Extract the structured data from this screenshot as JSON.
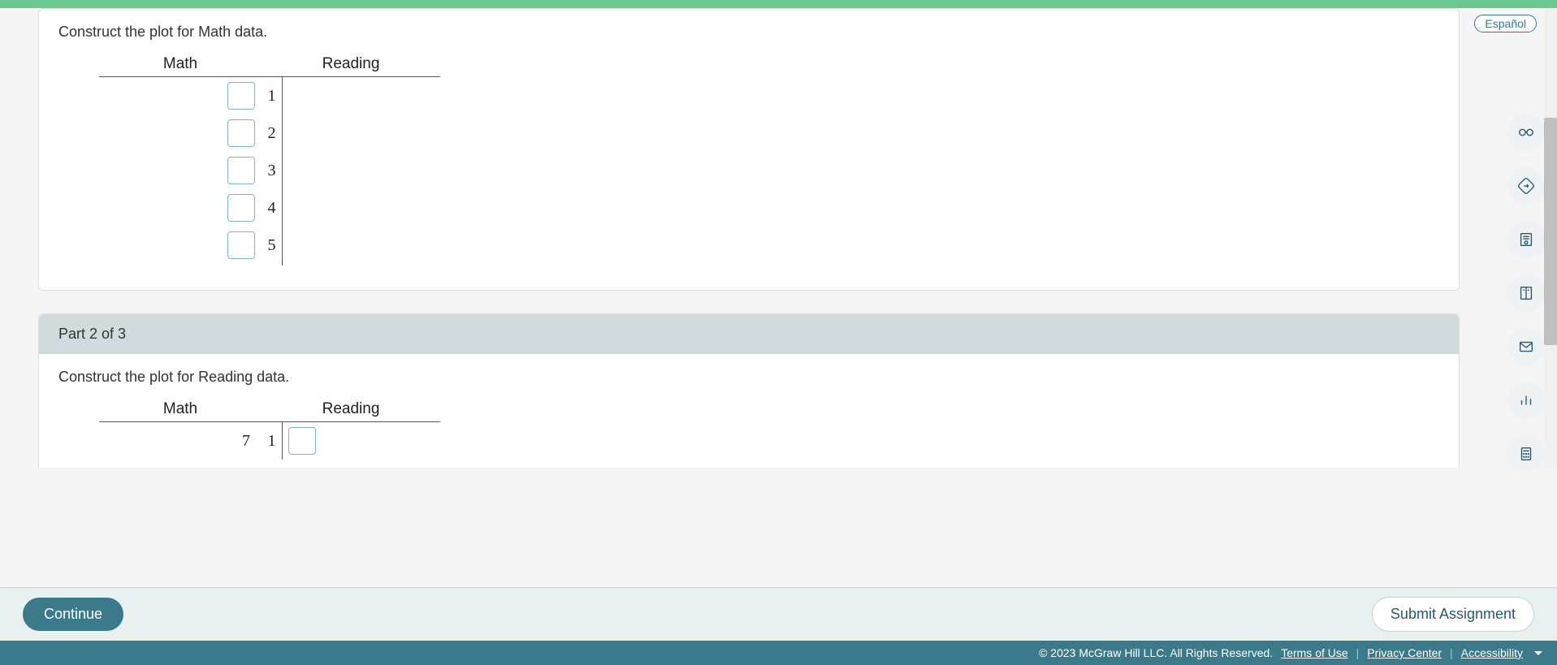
{
  "language_button": "Español",
  "part1": {
    "prompt": "Construct the plot for Math data.",
    "header_left": "Math",
    "header_right": "Reading",
    "stems": [
      "1",
      "2",
      "3",
      "4",
      "5"
    ]
  },
  "part2": {
    "title": "Part 2 of 3",
    "prompt": "Construct the plot for Reading data.",
    "header_left": "Math",
    "header_right": "Reading",
    "row1_left_leaf": "7",
    "row1_stem": "1"
  },
  "buttons": {
    "continue": "Continue",
    "submit": "Submit Assignment"
  },
  "footer": {
    "copyright": "© 2023 McGraw Hill LLC. All Rights Reserved.",
    "terms": "Terms of Use",
    "privacy": "Privacy Center",
    "accessibility": "Accessibility"
  }
}
